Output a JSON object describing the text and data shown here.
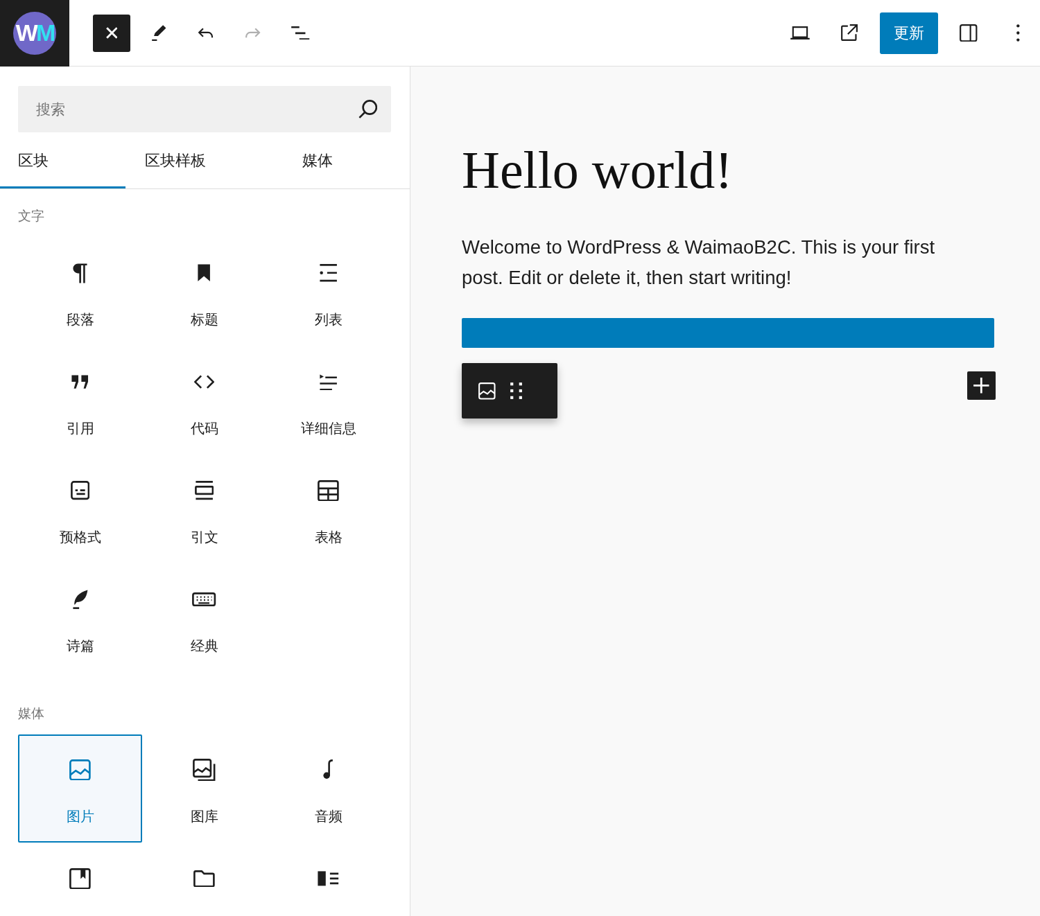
{
  "topbar": {
    "logo": [
      "W",
      "M"
    ],
    "tools": [
      {
        "kind": "close",
        "pressed": true,
        "disabled": false
      },
      {
        "kind": "pen",
        "pressed": false,
        "disabled": false
      },
      {
        "kind": "undo",
        "pressed": false,
        "disabled": false
      },
      {
        "kind": "redo",
        "pressed": false,
        "disabled": true
      },
      {
        "kind": "list-view",
        "pressed": false,
        "disabled": false
      }
    ],
    "actions": [
      {
        "kind": "preview"
      },
      {
        "kind": "view-post"
      },
      {
        "kind": "primary",
        "label": "更新"
      },
      {
        "kind": "sidebar"
      },
      {
        "kind": "more"
      }
    ]
  },
  "inserter": {
    "search": {
      "placeholder": "搜索"
    },
    "tabs": [
      {
        "label": "区块",
        "selected": true
      },
      {
        "label": "区块样板",
        "selected": false
      },
      {
        "label": "媒体",
        "selected": false
      }
    ],
    "sections": [
      {
        "title": "文字",
        "blocks": [
          {
            "label": "段落",
            "kind": "paragraph",
            "selected": false
          },
          {
            "label": "标题",
            "kind": "heading",
            "selected": false
          },
          {
            "label": "列表",
            "kind": "list",
            "selected": false
          },
          {
            "label": "引用",
            "kind": "quote",
            "selected": false
          },
          {
            "label": "代码",
            "kind": "code",
            "selected": false
          },
          {
            "label": "详细信息",
            "kind": "details",
            "selected": false
          },
          {
            "label": "预格式",
            "kind": "preformatted",
            "selected": false
          },
          {
            "label": "引文",
            "kind": "pullquote",
            "selected": false
          },
          {
            "label": "表格",
            "kind": "table",
            "selected": false
          },
          {
            "label": "诗篇",
            "kind": "verse",
            "selected": false
          },
          {
            "label": "经典",
            "kind": "classic",
            "selected": false
          }
        ]
      },
      {
        "title": "媒体",
        "blocks": [
          {
            "label": "图片",
            "kind": "image",
            "selected": true
          },
          {
            "label": "图库",
            "kind": "gallery",
            "selected": false
          },
          {
            "label": "音频",
            "kind": "audio",
            "selected": false
          },
          {
            "kind": "cover",
            "selected": false
          },
          {
            "kind": "file",
            "selected": false
          },
          {
            "kind": "media-text",
            "selected": false
          }
        ]
      }
    ]
  },
  "canvas": {
    "title": "Hello world!",
    "paragraph": "Welcome to WordPress & WaimaoB2C. This is your first post. Edit or delete it, then start writing!"
  }
}
